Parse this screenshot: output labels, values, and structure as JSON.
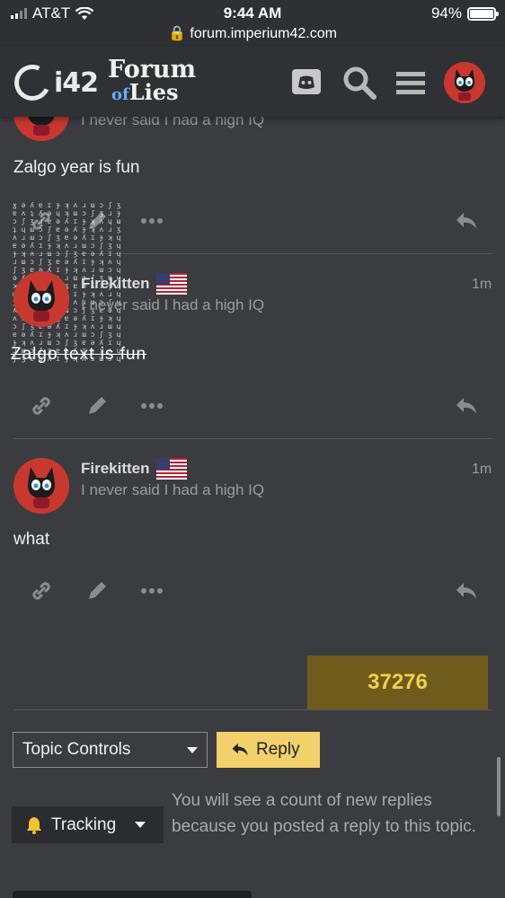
{
  "status_bar": {
    "carrier": "AT&T",
    "time": "9:44 AM",
    "battery": "94%",
    "url": "forum.imperium42.com"
  },
  "header": {
    "logo_text": "i42",
    "forum_logo_line1": "Forum",
    "forum_logo_of": "of",
    "forum_logo_line2": "Lies",
    "icons": [
      "discord-icon",
      "search-icon",
      "hamburger-menu-icon",
      "user-avatar"
    ]
  },
  "posts": [
    {
      "user_title": "I never said I had a high IQ",
      "body": "Zalgo year is fun"
    },
    {
      "username": "Firekitten",
      "user_title": "I never said I had a high IQ",
      "time": "1m",
      "body": "Zalgo text is fun"
    },
    {
      "username": "Firekitten",
      "user_title": "I never said I had a high IQ",
      "time": "1m",
      "body": "what"
    }
  ],
  "counter": "37276",
  "footer": {
    "topic_controls_label": "Topic Controls",
    "reply_label": "Reply",
    "tracking_label": "Tracking",
    "notification_note": "You will see a count of new replies because you posted a reply to this topic."
  },
  "colors": {
    "background": "#3a3c40",
    "header": "#2f3134",
    "reply_button": "#f2d16b",
    "counter_bg": "#6f5c1c",
    "counter_text": "#f1d04b"
  }
}
